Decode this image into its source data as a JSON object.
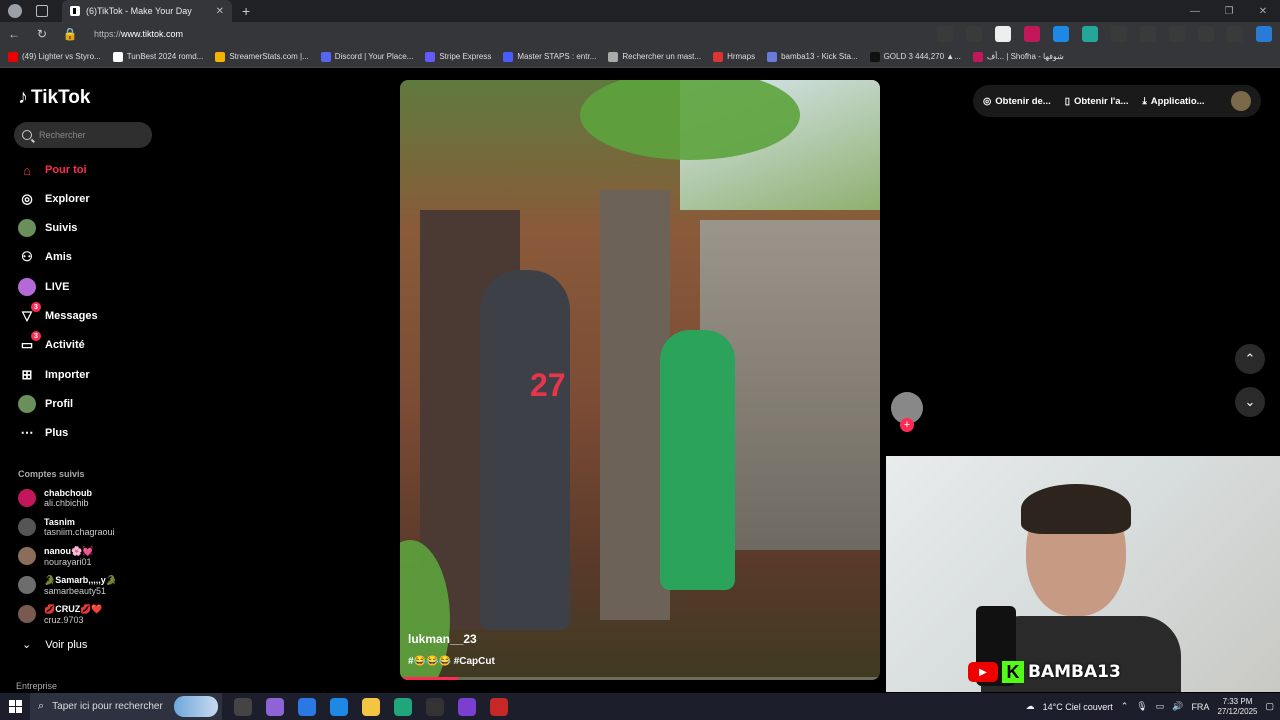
{
  "browser": {
    "tab_title": "(6)TikTok - Make Your Day",
    "url_prefix": "https://",
    "url_host": "www.tiktok.com",
    "bookmarks": [
      {
        "label": "(49) Lighter vs Styro...",
        "color": "#e00"
      },
      {
        "label": "TunBest 2024 romd...",
        "color": "#fff"
      },
      {
        "label": "StreamerStats.com |...",
        "color": "#f4b400"
      },
      {
        "label": "Discord | Your Place...",
        "color": "#5865f2"
      },
      {
        "label": "Stripe Express",
        "color": "#635bff"
      },
      {
        "label": "Master STAPS : entr...",
        "color": "#4a5cff"
      },
      {
        "label": "Rechercher un mast...",
        "color": "#aaa"
      },
      {
        "label": "Hrmaps",
        "color": "#d33"
      },
      {
        "label": "bamba13 - Kick Sta...",
        "color": "#6b7bd9"
      },
      {
        "label": "GOLD 3 444,270 ▲...",
        "color": "#111"
      },
      {
        "label": "أف... | Shofha - شوفها",
        "color": "#c2185b"
      }
    ]
  },
  "sidebar": {
    "logo": "TikTok",
    "search_placeholder": "Rechercher",
    "nav": [
      {
        "label": "Pour toi",
        "icon": "home-icon"
      },
      {
        "label": "Explorer",
        "icon": "compass-icon"
      },
      {
        "label": "Suivis",
        "icon": "following-avatar-icon"
      },
      {
        "label": "Amis",
        "icon": "friends-icon"
      },
      {
        "label": "LIVE",
        "icon": "live-icon"
      },
      {
        "label": "Messages",
        "icon": "messages-icon",
        "badge": "3"
      },
      {
        "label": "Activité",
        "icon": "activity-icon",
        "badge": "3"
      },
      {
        "label": "Importer",
        "icon": "upload-icon"
      },
      {
        "label": "Profil",
        "icon": "profile-icon"
      },
      {
        "label": "Plus",
        "icon": "more-icon"
      }
    ],
    "followed_title": "Comptes suivis",
    "followed": [
      {
        "name": "chabchoub",
        "handle": "ali.chbichib"
      },
      {
        "name": "Tasnim",
        "handle": "tasniim.chagraoui"
      },
      {
        "name": "nanou🌸💓",
        "handle": "nourayari01"
      },
      {
        "name": "🐊Samarb,,,,,y🐊",
        "handle": "samarbeauty51"
      },
      {
        "name": "💋CRUZ💋❤️",
        "handle": "cruz.9703"
      }
    ],
    "see_more": "Voir plus",
    "footer": "Entreprise"
  },
  "video": {
    "author": "lukman__23",
    "caption": "#😂😂😂 #CapCut",
    "progress": 0.12
  },
  "topbar": {
    "items": [
      "Obtenir de...",
      "Obtenir l'a...",
      "Applicatio..."
    ]
  },
  "webcam": {
    "channel": "BAMBA13",
    "kick_letter": "K"
  },
  "taskbar": {
    "search_placeholder": "Taper ici pour rechercher",
    "weather": "14°C  Ciel couvert",
    "lang": "FRA",
    "time": "7:33 PM",
    "date": "27/12/2025"
  }
}
